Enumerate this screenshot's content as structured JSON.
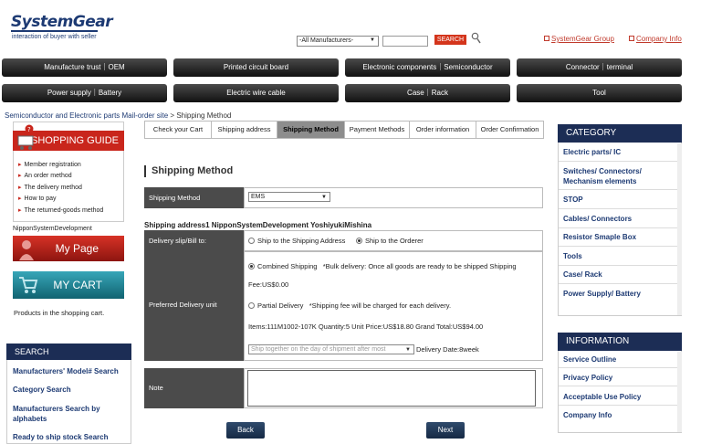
{
  "header": {
    "logo": "SystemGear",
    "tagline": "interaction of buyer with seller",
    "manufacturer_select": "-All Manufacturers-",
    "search_placeholder": "",
    "search_label": "SEARCH",
    "links": [
      "SystemGear Group",
      "Company Info"
    ]
  },
  "nav": {
    "row1": [
      "Manufacture trust｜OEM",
      "Printed circuit board",
      "Electronic components｜Semiconductor",
      "Connector｜terminal"
    ],
    "row2": [
      "Power supply｜Battery",
      "Electric wire cable",
      "Case｜Rack",
      "Tool"
    ]
  },
  "breadcrumb": {
    "link": "Semiconductor and Electronic parts Mail-order site",
    "sep": ">",
    "current": "Shipping Method"
  },
  "guide": {
    "title": "SHOPPING GUIDE",
    "items": [
      "Member registration",
      "An order method",
      "The delivery method",
      "How to pay",
      "The returned-goods method"
    ]
  },
  "user": {
    "name": "NipponSystemDevelopment",
    "my_page": "My Page",
    "my_cart": "MY CART",
    "cart_note": "Products in the shopping cart."
  },
  "search_panel": {
    "title": "SEARCH",
    "items": [
      "Manufacturers' Model# Search",
      "Category Search",
      "Manufacturers Search by alphabets",
      "Ready to ship stock Search"
    ]
  },
  "steps": [
    {
      "label": "Check your Cart",
      "active": false
    },
    {
      "label": "Shipping address",
      "active": false
    },
    {
      "label": "Shipping Method",
      "active": true
    },
    {
      "label": "Payment Methods",
      "active": false
    },
    {
      "label": "Order information",
      "active": false
    },
    {
      "label": "Order Confirmation",
      "active": false
    }
  ],
  "main": {
    "title": "Shipping Method",
    "method_label": "Shipping Method",
    "method_value": "EMS",
    "address_line": "Shipping address1 NipponSystemDevelopment YoshiyukiMishina",
    "delivery_label": "Delivery slip/Bill to:",
    "delivery_opt1": "Ship to the Shipping Address",
    "delivery_opt2": "Ship to the Orderer",
    "pref_label": "Preferred Delivery unit",
    "combined": "Combined Shipping",
    "combined_note": "*Bulk delivery: Once all goods are ready to be shipped Shipping Fee:US$0.00",
    "partial": "Partial Delivery",
    "partial_note": "*Shipping fee will be charged for each delivery.",
    "items_line": "Items:111M1002-107K Quantity:5 Unit Price:US$18.80 Grand Total:US$94.00",
    "ship_select": "Ship together on the day of shipment after most",
    "delivery_date": "Delivery Date:8week",
    "note_label": "Note",
    "back": "Back",
    "next": "Next"
  },
  "category": {
    "title": "CATEGORY",
    "items": [
      "Electric parts/ IC",
      "Switches/ Connectors/ Mechanism elements",
      "STOP",
      "Cables/ Connectors",
      "Resistor Smaple Box",
      "Tools",
      "Case/ Rack",
      "Power Supply/ Battery"
    ]
  },
  "information": {
    "title": "INFORMATION",
    "items": [
      "Service Outline",
      "Privacy Policy",
      "Acceptable Use Policy",
      "Company Info"
    ]
  }
}
